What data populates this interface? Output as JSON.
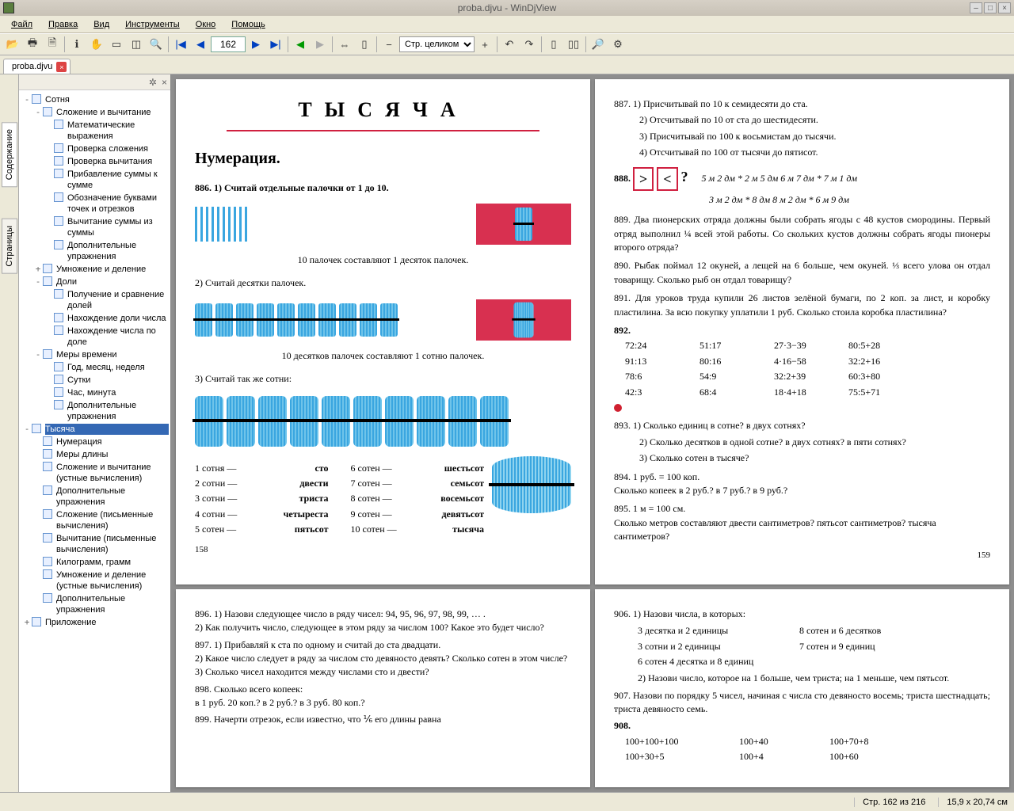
{
  "window": {
    "title": "proba.djvu - WinDjView"
  },
  "menu": [
    "Файл",
    "Правка",
    "Вид",
    "Инструменты",
    "Окно",
    "Помощь"
  ],
  "toolbar": {
    "page_current": "162",
    "zoom_mode": "Стр. целиком"
  },
  "tab": {
    "label": "proba.djvu"
  },
  "side_tabs": {
    "contents": "Содержание",
    "pages": "Страницы"
  },
  "tree": [
    {
      "d": 0,
      "exp": "-",
      "lbl": "Сотня"
    },
    {
      "d": 1,
      "exp": "-",
      "lbl": "Сложение и вычитание"
    },
    {
      "d": 2,
      "exp": "",
      "lbl": "Математические выражения"
    },
    {
      "d": 2,
      "exp": "",
      "lbl": "Проверка сложения"
    },
    {
      "d": 2,
      "exp": "",
      "lbl": "Проверка вычитания"
    },
    {
      "d": 2,
      "exp": "",
      "lbl": "Прибавление суммы к сумме"
    },
    {
      "d": 2,
      "exp": "",
      "lbl": "Обозначение буквами точек и отрезков"
    },
    {
      "d": 2,
      "exp": "",
      "lbl": "Вычитание суммы из суммы"
    },
    {
      "d": 2,
      "exp": "",
      "lbl": "Дополнительные упражнения"
    },
    {
      "d": 1,
      "exp": "+",
      "lbl": "Умножение и деление"
    },
    {
      "d": 1,
      "exp": "-",
      "lbl": "Доли"
    },
    {
      "d": 2,
      "exp": "",
      "lbl": "Получение и сравнение долей"
    },
    {
      "d": 2,
      "exp": "",
      "lbl": "Нахождение доли числа"
    },
    {
      "d": 2,
      "exp": "",
      "lbl": "Нахождение числа по доле"
    },
    {
      "d": 1,
      "exp": "-",
      "lbl": "Меры времени"
    },
    {
      "d": 2,
      "exp": "",
      "lbl": "Год, месяц, неделя"
    },
    {
      "d": 2,
      "exp": "",
      "lbl": "Сутки"
    },
    {
      "d": 2,
      "exp": "",
      "lbl": "Час, минута"
    },
    {
      "d": 2,
      "exp": "",
      "lbl": "Дополнительные упражнения"
    },
    {
      "d": 0,
      "exp": "-",
      "lbl": "Тысяча",
      "sel": true
    },
    {
      "d": 1,
      "exp": "",
      "lbl": "Нумерация"
    },
    {
      "d": 1,
      "exp": "",
      "lbl": "Меры длины"
    },
    {
      "d": 1,
      "exp": "",
      "lbl": "Сложение и вычитание (устные вычисления)"
    },
    {
      "d": 1,
      "exp": "",
      "lbl": "Дополнительные упражнения"
    },
    {
      "d": 1,
      "exp": "",
      "lbl": "Сложение (письменные вычисления)"
    },
    {
      "d": 1,
      "exp": "",
      "lbl": "Вычитание (письменные вычисления)"
    },
    {
      "d": 1,
      "exp": "",
      "lbl": "Килограмм, грамм"
    },
    {
      "d": 1,
      "exp": "",
      "lbl": "Умножение и деление (устные вычисления)"
    },
    {
      "d": 1,
      "exp": "",
      "lbl": "Дополнительные упражнения"
    },
    {
      "d": 0,
      "exp": "+",
      "lbl": "Приложение"
    }
  ],
  "p158": {
    "title": "ТЫСЯЧА",
    "h2": "Нумерация.",
    "e886_1": "886. 1) Считай отдельные палочки от 1 до 10.",
    "cap1": "10 палочек составляют 1 десяток палочек.",
    "e886_2": "2) Считай десятки палочек.",
    "cap2": "10 десятков палочек составляют 1 сотню палочек.",
    "e886_3": "3) Считай так же сотни:",
    "hundreds_left": [
      [
        "1 сотня —",
        "сто"
      ],
      [
        "2 сотни —",
        "двести"
      ],
      [
        "3 сотни —",
        "триста"
      ],
      [
        "4 сотни —",
        "четыреста"
      ],
      [
        "5 сотен —",
        "пятьсот"
      ]
    ],
    "hundreds_right": [
      [
        "6 сотен —",
        "шестьсот"
      ],
      [
        "7 сотен —",
        "семьсот"
      ],
      [
        "8 сотен —",
        "восемьсот"
      ],
      [
        "9 сотен —",
        "девятьсот"
      ],
      [
        "10 сотен —",
        "тысяча"
      ]
    ],
    "pgnum": "158"
  },
  "p159": {
    "e887": [
      "887. 1) Присчитывай по 10 к семидесяти до ста.",
      "2) Отсчитывай по 10 от ста до шестидесяти.",
      "3) Присчитывай по 100 к восьмистам до тысячи.",
      "4) Отсчитывай по 100 от тысячи до пятисот."
    ],
    "e888_sym": "> < ?",
    "e888_a": "5 м 2 дм * 2 м 5 дм    6 м 7 дм * 7 м 1 дм",
    "e888_b": "3 м 2 дм * 8 дм        8 м 2 дм * 6 м 9 дм",
    "e889": "889. Два пионерских отряда должны были собрать ягоды с 48 кустов смородины. Первый отряд выполнил ¼ всей этой работы. Со скольких кустов должны собрать ягоды пионеры второго отряда?",
    "e890": "890. Рыбак поймал 12 окуней, а лещей на 6 больше, чем окуней. ⅓ всего улова он отдал товарищу. Сколько рыб он отдал товарищу?",
    "e891": "891. Для уроков труда купили 26 листов зелёной бумаги, по 2 коп. за лист, и коробку пластилина. За всю покупку уплатили 1 руб. Сколько стоила коробка пластилина?",
    "e892_rows": [
      [
        "72:24",
        "51:17",
        "27·3−39",
        "80:5+28"
      ],
      [
        "91:13",
        "80:16",
        "4·16−58",
        "32:2+16"
      ],
      [
        "78:6",
        "54:9",
        "32:2+39",
        "60:3+80"
      ],
      [
        "42:3",
        "68:4",
        "18·4+18",
        "75:5+71"
      ]
    ],
    "e893": [
      "893. 1) Сколько единиц в сотне? в двух сотнях?",
      "2) Сколько десятков в одной сотне? в двух сотнях? в пяти сотнях?",
      "3) Сколько сотен в тысяче?"
    ],
    "e894": "894. 1 руб. = 100 коп.\nСколько копеек в 2 руб.? в 7 руб.? в 9 руб.?",
    "e895": "895. 1 м = 100 см.\nСколько метров составляют двести сантиметров? пятьсот сантиметров? тысяча сантиметров?",
    "pgnum": "159"
  },
  "p160": {
    "e896": "896. 1) Назови следующее число в ряду чисел: 94, 95, 96, 97, 98, 99, … .\n2) Как получить число, следующее в этом ряду за числом 100? Какое это будет число?",
    "e897": "897. 1) Прибавляй к ста по одному и считай до ста двадцати.\n2) Какое число следует в ряду за числом сто девяносто девять? Сколько сотен в этом числе?\n3) Сколько чисел находится между числами сто и двести?",
    "e898": "898. Сколько всего копеек:\nв 1 руб. 20 коп.? в 2 руб.? в 3 руб. 80 коп.?",
    "e899": "899. Начерти отрезок, если известно, что ⅙ его длины равна"
  },
  "p161": {
    "e906_head": "906. 1) Назови числа, в которых:",
    "e906_rows": [
      [
        "3 десятка и 2 единицы",
        "8 сотен и 6 десятков"
      ],
      [
        "3 сотни и 2 единицы",
        "7 сотен и 9 единиц"
      ],
      [
        "6 сотен 4 десятка и 8 единиц",
        ""
      ]
    ],
    "e906_2": "2) Назови число, которое на 1 больше, чем триста; на 1 меньше, чем пятьсот.",
    "e907": "907. Назови по порядку 5 чисел, начиная с числа сто девяносто восемь; триста шестнадцать; триста девяносто семь.",
    "e908_rows": [
      [
        "100+100+100",
        "100+40",
        "100+70+8"
      ],
      [
        "100+30+5",
        "100+4",
        "100+60"
      ]
    ]
  },
  "status": {
    "page": "Стр. 162 из 216",
    "size": "15,9 x 20,74 см"
  }
}
